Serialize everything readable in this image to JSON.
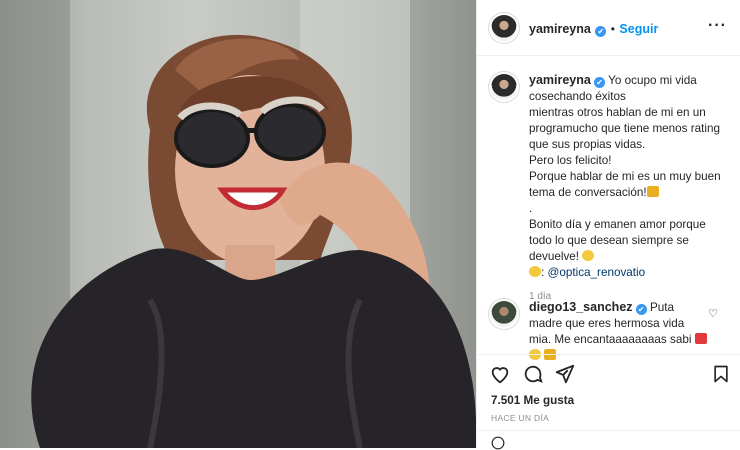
{
  "post": {
    "username": "yamireyna",
    "follow_label": "Seguir",
    "separator": "•",
    "verified_glyph": "✔",
    "more_glyph": "···"
  },
  "caption": {
    "username": "yamireyna",
    "lines": [
      "Yo ocupo mi vida cosechando éxitos",
      "mientras otros hablan de mi en un programucho que tiene menos rating que sus propias vidas.",
      "Pero los felicito!",
      "Porque hablar de mi es un muy buen tema de conversación!",
      ".",
      "Bonito día y emanen amor porque todo lo que desean siempre se devuelve!",
      ": @optica_renovatio"
    ],
    "tag": "@optica_renovatio",
    "time_ago": "1 día"
  },
  "comment": {
    "username": "diego13_sanchez",
    "text": "Puta madre que eres hermosa vida mia. Me encantaaaaaaaas sabi"
  },
  "likes": "7.501 Me gusta",
  "posted": "HACE UN DÍA",
  "colors": {
    "link": "#0095f6",
    "verified": "#3897f0",
    "tag": "#00376b",
    "muted": "#8e8e8e"
  },
  "icons": [
    "heart-icon",
    "comment-icon",
    "share-icon",
    "bookmark-icon",
    "more-icon",
    "heart-small-icon"
  ]
}
